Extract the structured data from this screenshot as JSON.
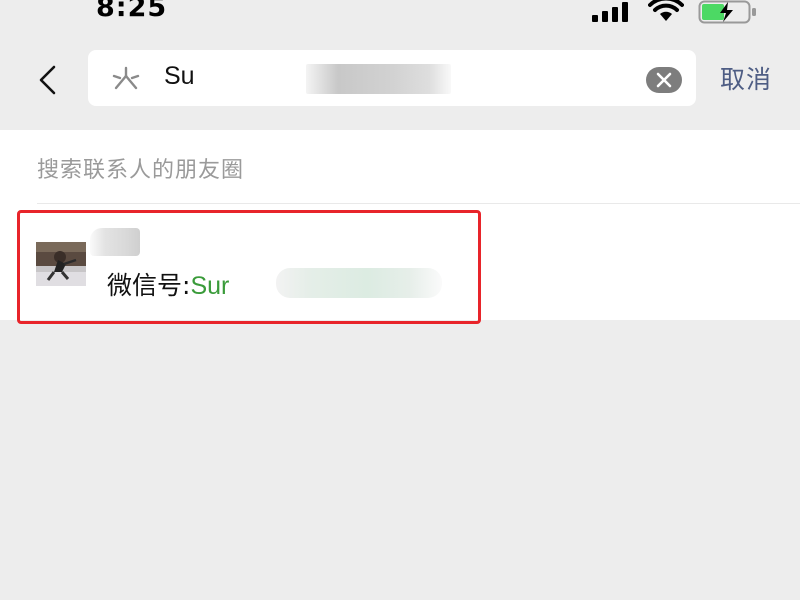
{
  "status_bar": {
    "time": "8:25",
    "icons": [
      "signal-icon",
      "wifi-icon",
      "battery-charging-icon"
    ],
    "battery_color": "#4cd964"
  },
  "search": {
    "back_icon": "chevron-left-icon",
    "voice_icon": "voice-input-icon",
    "query_visible": "Su",
    "clear_icon": "clear-icon",
    "cancel_label": "取消"
  },
  "moments": {
    "hint": "搜索联系人的朋友圈"
  },
  "result": {
    "avatar_icon": "avatar-photo",
    "id_label": "微信号:",
    "id_value_visible": "Sur",
    "id_color": "#3a9b3a",
    "highlight_color": "#e8242a"
  }
}
